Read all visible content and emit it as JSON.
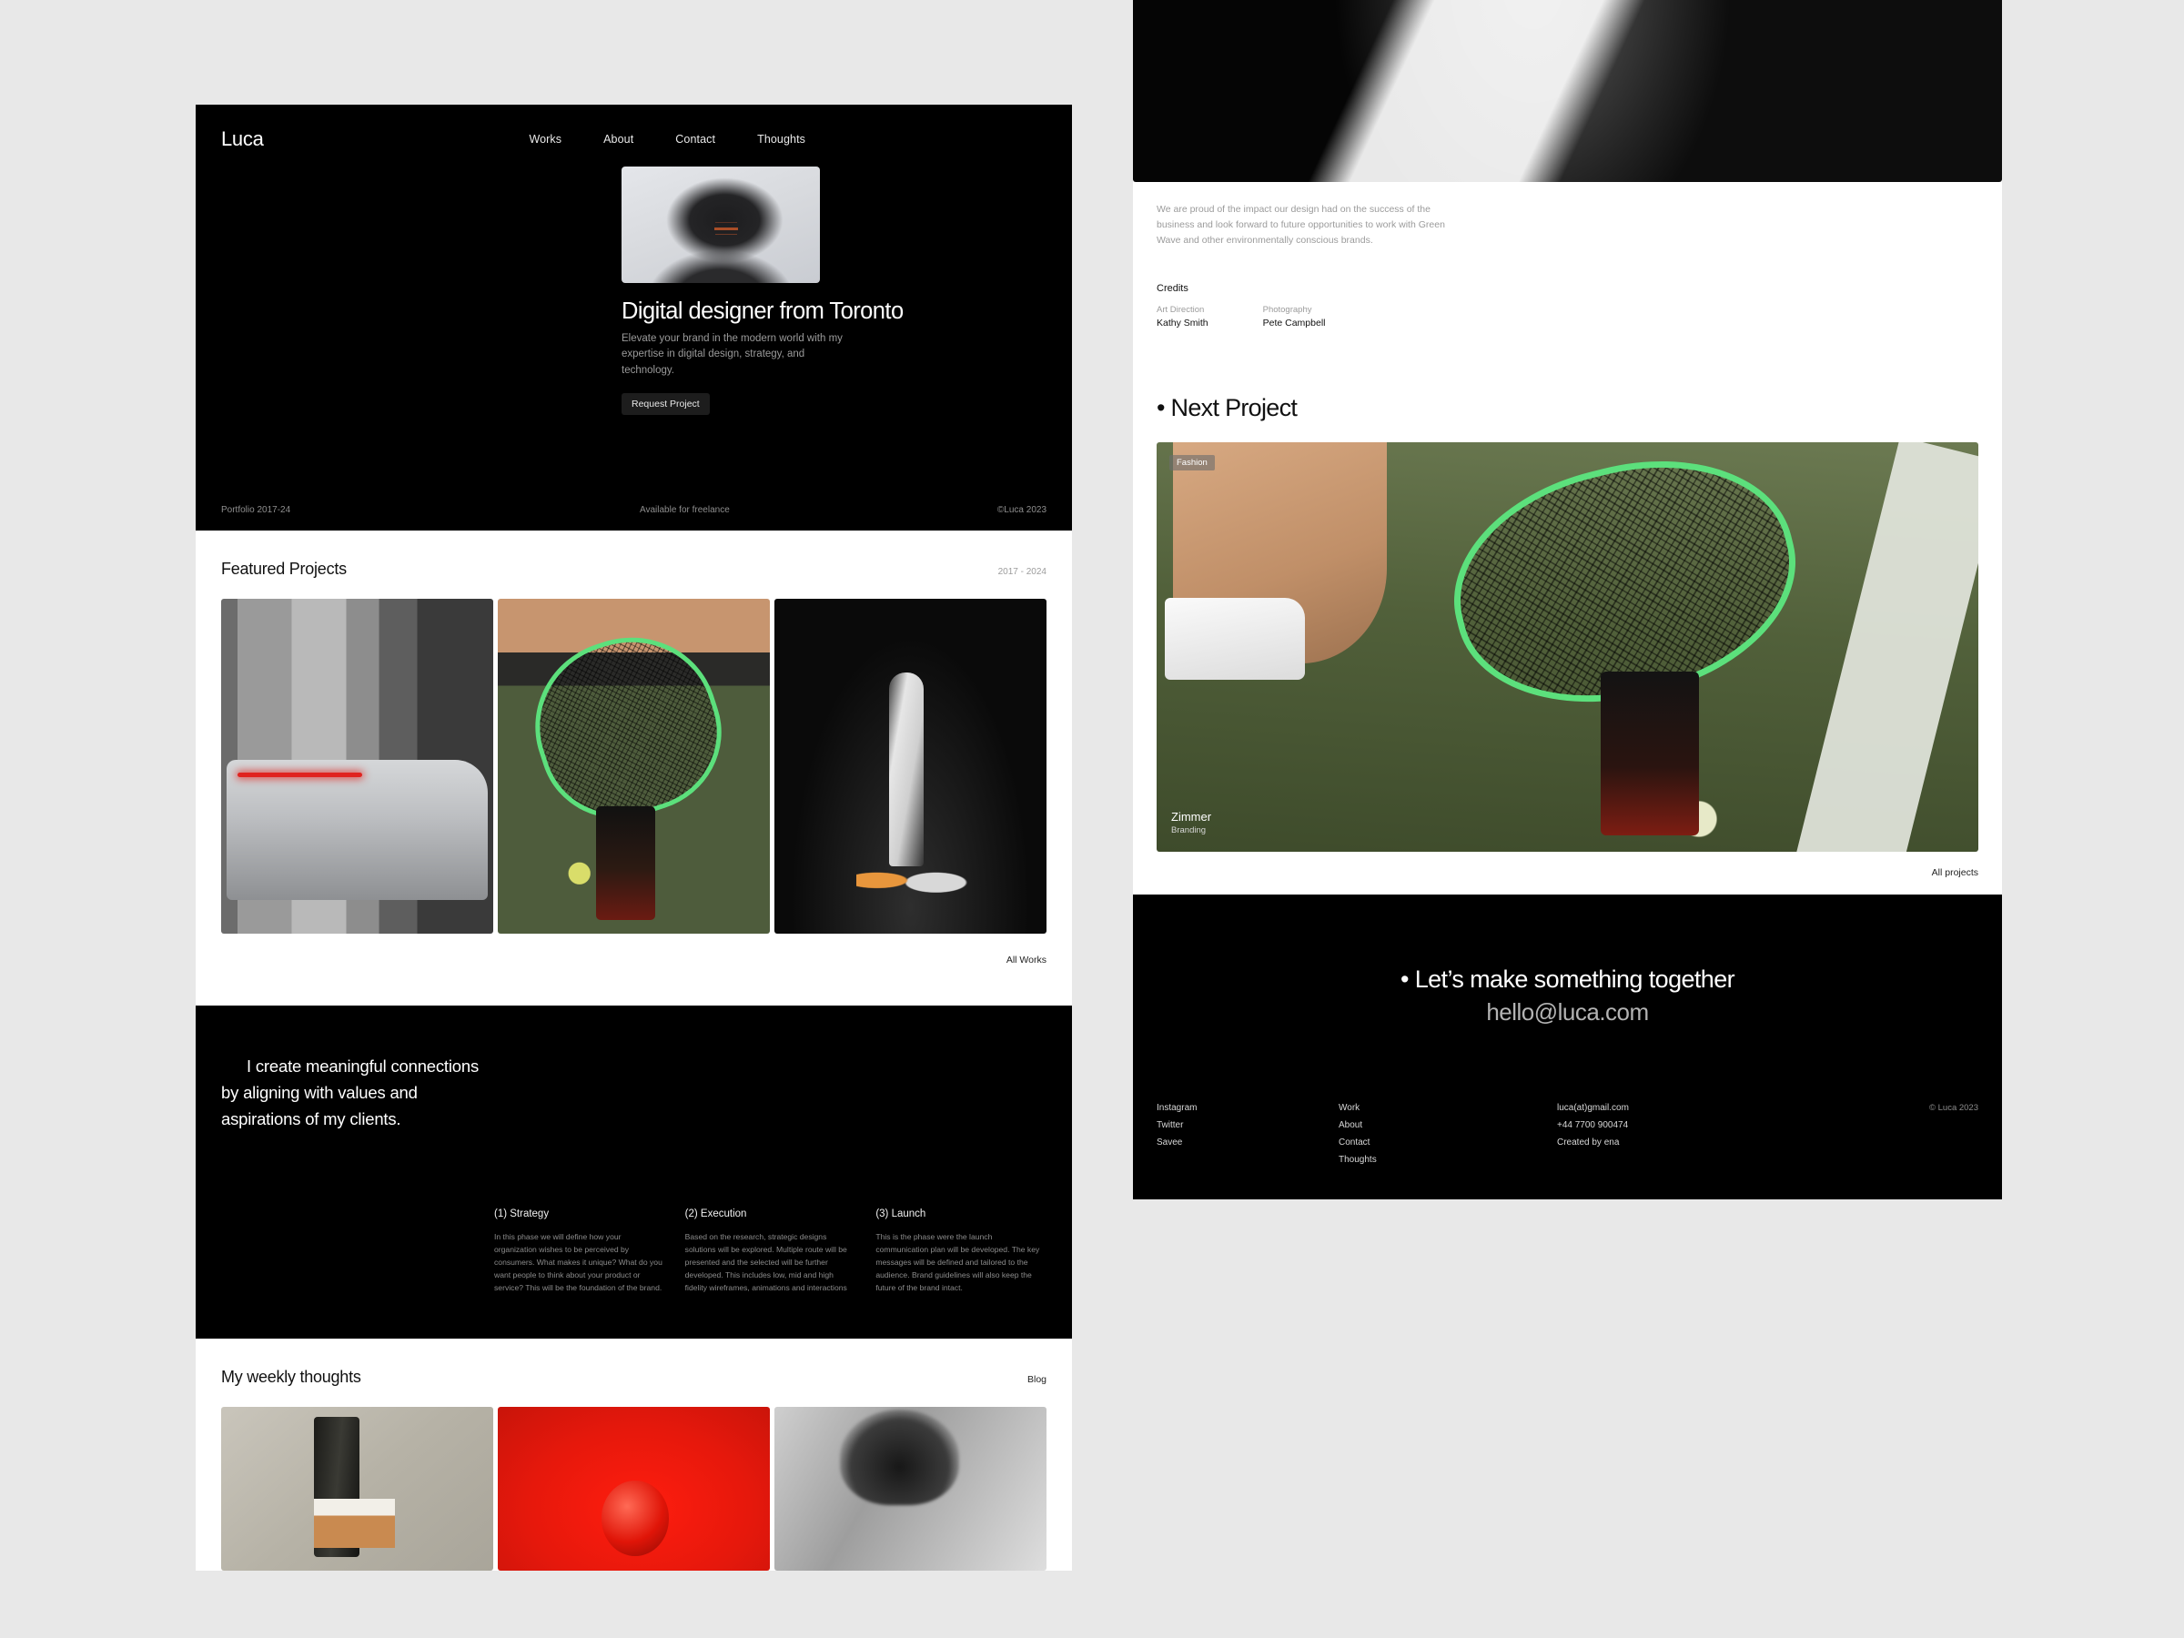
{
  "site": {
    "brand": "Luca",
    "nav": [
      {
        "label": "Works"
      },
      {
        "label": "About"
      },
      {
        "label": "Contact"
      },
      {
        "label": "Thoughts"
      }
    ]
  },
  "hero": {
    "title": "Digital designer from Toronto",
    "subtitle": "Elevate your brand in the modern world with my expertise in digital design, strategy, and technology.",
    "cta_label": "Request Project",
    "footer_left": "Portfolio 2017-24",
    "footer_center": "Available for freelance",
    "footer_right": "©Luca 2023",
    "portrait_alt": "portrait-photo"
  },
  "featured": {
    "title": "Featured Projects",
    "meta": "2017 - 2024",
    "all_link": "All Works",
    "cards": [
      {
        "name": "car-taillight-photo"
      },
      {
        "name": "tennis-racket-photo"
      },
      {
        "name": "bottle-still-life-photo"
      }
    ]
  },
  "statement": {
    "line1": "I create meaningful connections",
    "line2": "by aligning with values and",
    "line3": "aspirations of my clients.",
    "process": [
      {
        "heading": "(1) Strategy",
        "body": "In this phase we will define how your organization wishes to be perceived by consumers. What makes it unique? What do you want people to think about your product or service? This will be the foundation of the brand."
      },
      {
        "heading": "(2) Execution",
        "body": "Based on the research, strategic designs solutions will be explored. Multiple route will be presented and the selected will be further developed. This includes low, mid and high fidelity wireframes, animations and interactions"
      },
      {
        "heading": "(3) Launch",
        "body": "This is the phase were the launch communication plan will be developed. The key messages will be defined and tailored to the audience. Brand guidelines will also keep the future of the brand intact."
      }
    ]
  },
  "thoughts": {
    "title": "My weekly thoughts",
    "blog_link": "Blog",
    "cards": [
      {
        "name": "aesop-body-spray-photo"
      },
      {
        "name": "red-fruit-photo"
      },
      {
        "name": "black-white-portrait-photo"
      }
    ]
  },
  "project_page": {
    "hero_image_alt": "wine-bottle-label-photo",
    "paragraph": "We are proud of the impact our design had on the success of the business and look forward to future opportunities to work with Green Wave and other environmentally conscious brands.",
    "credits_heading": "Credits",
    "credits": [
      {
        "role": "Art Direction",
        "name": "Kathy Smith"
      },
      {
        "role": "Photography",
        "name": "Pete Campbell"
      }
    ],
    "next_heading": "• Next Project",
    "next_card": {
      "tag": "Fashion",
      "title": "Zimmer",
      "subtitle": "Branding",
      "image_alt": "tennis-court-racket-photo"
    },
    "all_projects_link": "All projects"
  },
  "cta": {
    "heading": "• Let’s make something together",
    "email": "hello@luca.com"
  },
  "footer": {
    "social": [
      {
        "label": "Instagram"
      },
      {
        "label": "Twitter"
      },
      {
        "label": "Savee"
      }
    ],
    "pages": [
      {
        "label": "Work"
      },
      {
        "label": "About"
      },
      {
        "label": "Contact"
      },
      {
        "label": "Thoughts"
      }
    ],
    "contact": [
      {
        "label": "luca(at)gmail.com"
      },
      {
        "label": "+44 7700 900474"
      },
      {
        "label": "Created by ena"
      }
    ],
    "copyright": "© Luca 2023"
  },
  "colors": {
    "dark": "#000000",
    "page_bg": "#e8e8e8",
    "accent_green": "#5ce07c",
    "accent_red": "#e0231f"
  }
}
